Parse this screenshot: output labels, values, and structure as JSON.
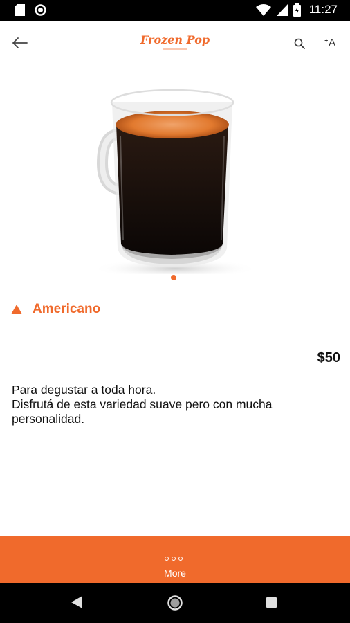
{
  "status_bar": {
    "time": "11:27",
    "icons": [
      "sd-card-icon",
      "notification-circle-icon",
      "wifi-icon",
      "signal-icon",
      "battery-icon"
    ]
  },
  "app_bar": {
    "logo_text": "Frozen Pop",
    "back_icon": "arrow-left-icon",
    "search_icon": "search-icon",
    "text_size_icon": "text-size-icon",
    "text_size_glyph": "ᐩA"
  },
  "product": {
    "image": "coffee-mug-image",
    "title": "Americano",
    "price": "$50",
    "description_lines": [
      "Para degustar a toda hora.",
      "Disfrutá de esta variedad suave pero con mucha",
      "personalidad."
    ],
    "carousel": {
      "count": 1,
      "active": 0
    }
  },
  "bottom_bar": {
    "label": "More",
    "icon": "more-dots-icon"
  },
  "colors": {
    "accent": "#f06a2c",
    "status_bar": "#000000",
    "nav_bar": "#000000"
  }
}
